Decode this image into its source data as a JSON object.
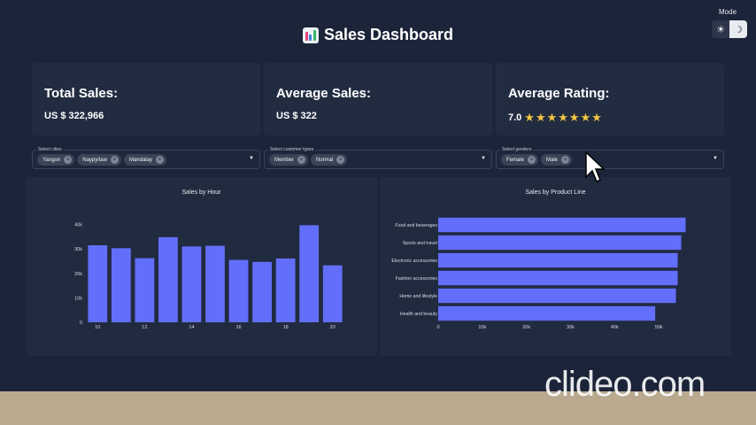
{
  "mode": {
    "label": "Mode",
    "light_icon": "☀",
    "dark_icon": "☽"
  },
  "header": {
    "title": "Sales Dashboard",
    "icon": "bar-chart-icon"
  },
  "kpis": [
    {
      "label": "Total Sales:",
      "value": "US $ 322,966"
    },
    {
      "label": "Average Sales:",
      "value": "US $ 322"
    },
    {
      "label": "Average Rating:",
      "value": "7.0",
      "stars": "★★★★★★★",
      "rating_value": 7
    }
  ],
  "filters": [
    {
      "label": "Select cities",
      "chips": [
        "Yangon",
        "Naypyitaw",
        "Mandalay"
      ]
    },
    {
      "label": "Select customer types",
      "chips": [
        "Member",
        "Normal"
      ]
    },
    {
      "label": "Select genders",
      "chips": [
        "Female",
        "Male"
      ]
    }
  ],
  "chip_remove": "×",
  "dropdown_arrow": "▼",
  "watermark": "clideo.com",
  "colors": {
    "bar": "#636efa",
    "background": "#1b2438",
    "panel": "#212b40",
    "star": "#f5c542"
  },
  "chart_data": [
    {
      "type": "bar",
      "title": "Sales by Hour",
      "x": [
        10,
        11,
        12,
        13,
        14,
        15,
        16,
        17,
        18,
        19,
        20
      ],
      "values": [
        31500,
        30300,
        26200,
        34800,
        31000,
        31300,
        25500,
        24700,
        26100,
        39700,
        23300
      ],
      "x_ticks": [
        10,
        12,
        14,
        16,
        18,
        20
      ],
      "y_ticks": [
        0,
        10000,
        20000,
        30000,
        40000
      ],
      "y_tick_labels": [
        "0",
        "10k",
        "20k",
        "30k",
        "40k"
      ],
      "ylim": [
        0,
        42000
      ],
      "xlabel": "",
      "ylabel": "",
      "grid": false
    },
    {
      "type": "bar",
      "orientation": "horizontal",
      "title": "Sales by Product Line",
      "categories": [
        "Food and beverages",
        "Sports and travel",
        "Electronic accessories",
        "Fashion accessories",
        "Home and lifestyle",
        "Health and beauty"
      ],
      "values": [
        56100,
        55100,
        54300,
        54300,
        53900,
        49200
      ],
      "x_ticks": [
        0,
        10000,
        20000,
        30000,
        40000,
        50000
      ],
      "x_tick_labels": [
        "0",
        "10k",
        "20k",
        "30k",
        "40k",
        "50k"
      ],
      "xlim": [
        0,
        58000
      ],
      "xlabel": "",
      "ylabel": "",
      "grid": false
    }
  ]
}
